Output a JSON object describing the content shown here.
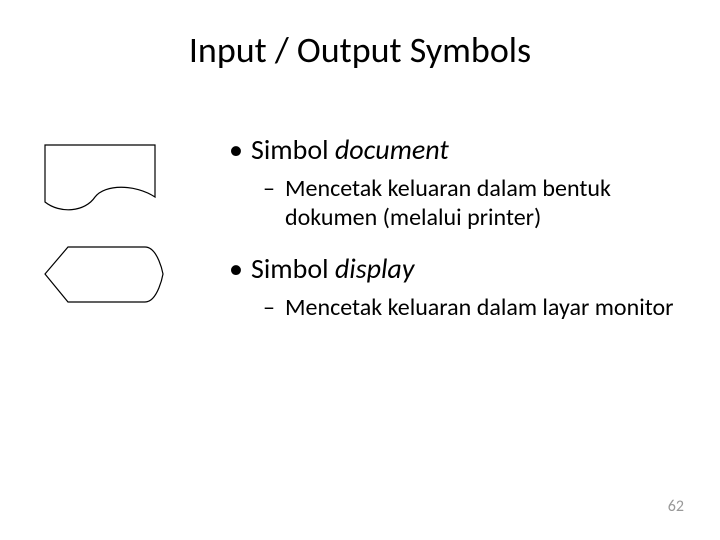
{
  "title": "Input / Output Symbols",
  "items": [
    {
      "label_prefix": "Simbol ",
      "label_italic": "document",
      "sub": "Mencetak keluaran dalam bentuk dokumen (melalui printer)"
    },
    {
      "label_prefix": "Simbol ",
      "label_italic": "display",
      "sub": "Mencetak keluaran dalam layar monitor"
    }
  ],
  "page_number": "62"
}
